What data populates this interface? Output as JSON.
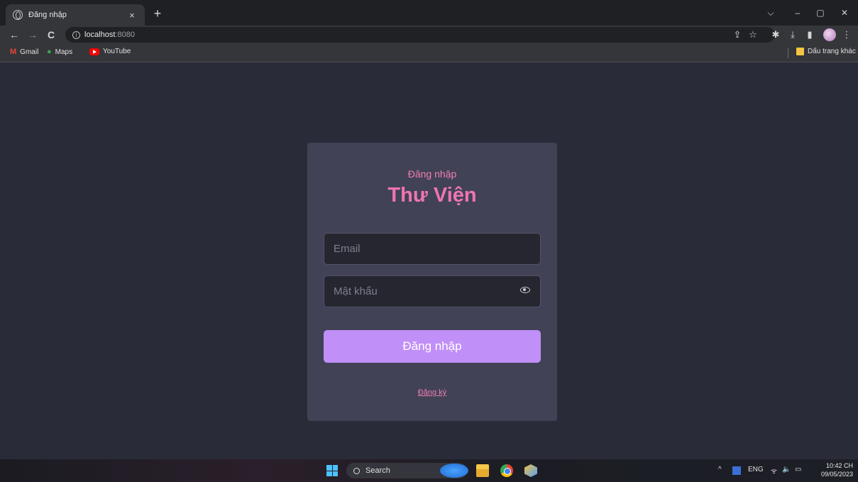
{
  "browser": {
    "tab": {
      "title": "Đăng nhập",
      "close": "×"
    },
    "new_tab": "+",
    "window_controls": {
      "list": "⌵",
      "minimize": "–",
      "maximize": "▢",
      "close": "✕"
    },
    "nav": {
      "back": "←",
      "forward": "→",
      "reload": "C"
    },
    "address": {
      "host": "localhost",
      "port": ":8080"
    },
    "toolbar_icons": {
      "share": "⇪",
      "star": "☆",
      "extensions": "✱",
      "download": "⤓",
      "sidepanel": "▮",
      "menu": "⋮"
    },
    "bookmarks": [
      {
        "label": "Gmail",
        "icon": "gmail-icon"
      },
      {
        "label": "Maps",
        "icon": "maps-icon"
      },
      {
        "label": "YouTube",
        "icon": "youtube-icon"
      }
    ],
    "other_bookmarks": "Dấu trang khác"
  },
  "login": {
    "subtitle": "Đăng nhập",
    "title": "Thư Viện",
    "email_placeholder": "Email",
    "password_placeholder": "Mật khẩu",
    "submit_label": "Đăng nhập",
    "register_link": "Đăng ký",
    "colors": {
      "accent_pink": "#ef75b1",
      "button": "#c08ff7",
      "card": "#414255",
      "background": "#2a2b38"
    }
  },
  "taskbar": {
    "search_label": "Search",
    "tray": {
      "chevron": "^",
      "language": "ENG",
      "wifi": "ᯤ",
      "volume": "🔈",
      "battery": "▭"
    },
    "time": "10:42 CH",
    "date": "09/05/2023"
  }
}
